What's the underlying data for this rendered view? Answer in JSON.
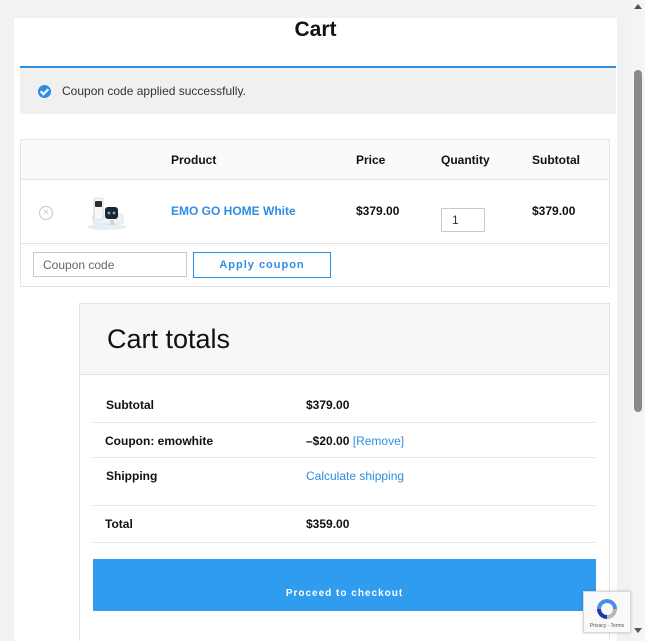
{
  "page": {
    "title": "Cart"
  },
  "notice": {
    "message": "Coupon code applied successfully."
  },
  "cart_table": {
    "headers": {
      "product": "Product",
      "price": "Price",
      "quantity": "Quantity",
      "subtotal": "Subtotal"
    },
    "items": [
      {
        "name": "EMO GO HOME White",
        "price": "$379.00",
        "quantity": "1",
        "subtotal": "$379.00"
      }
    ],
    "remove_icon": "remove-circle-x-icon"
  },
  "coupon": {
    "placeholder": "Coupon code",
    "value": "",
    "apply_label": "Apply coupon"
  },
  "cart_totals": {
    "title": "Cart totals",
    "subtotal_label": "Subtotal",
    "subtotal_value": "$379.00",
    "coupon_label": "Coupon: emowhite",
    "coupon_value": "–$20.00",
    "coupon_remove_label": "[Remove]",
    "shipping_label": "Shipping",
    "shipping_link": "Calculate shipping",
    "total_label": "Total",
    "total_value": "$359.00",
    "checkout_label": "Proceed to checkout"
  },
  "recaptcha": {
    "text": "Privacy - Terms"
  },
  "colors": {
    "accent": "#2f8de4",
    "checkout_button": "#2f9cf0",
    "notice_bg": "#f0f0f0"
  }
}
